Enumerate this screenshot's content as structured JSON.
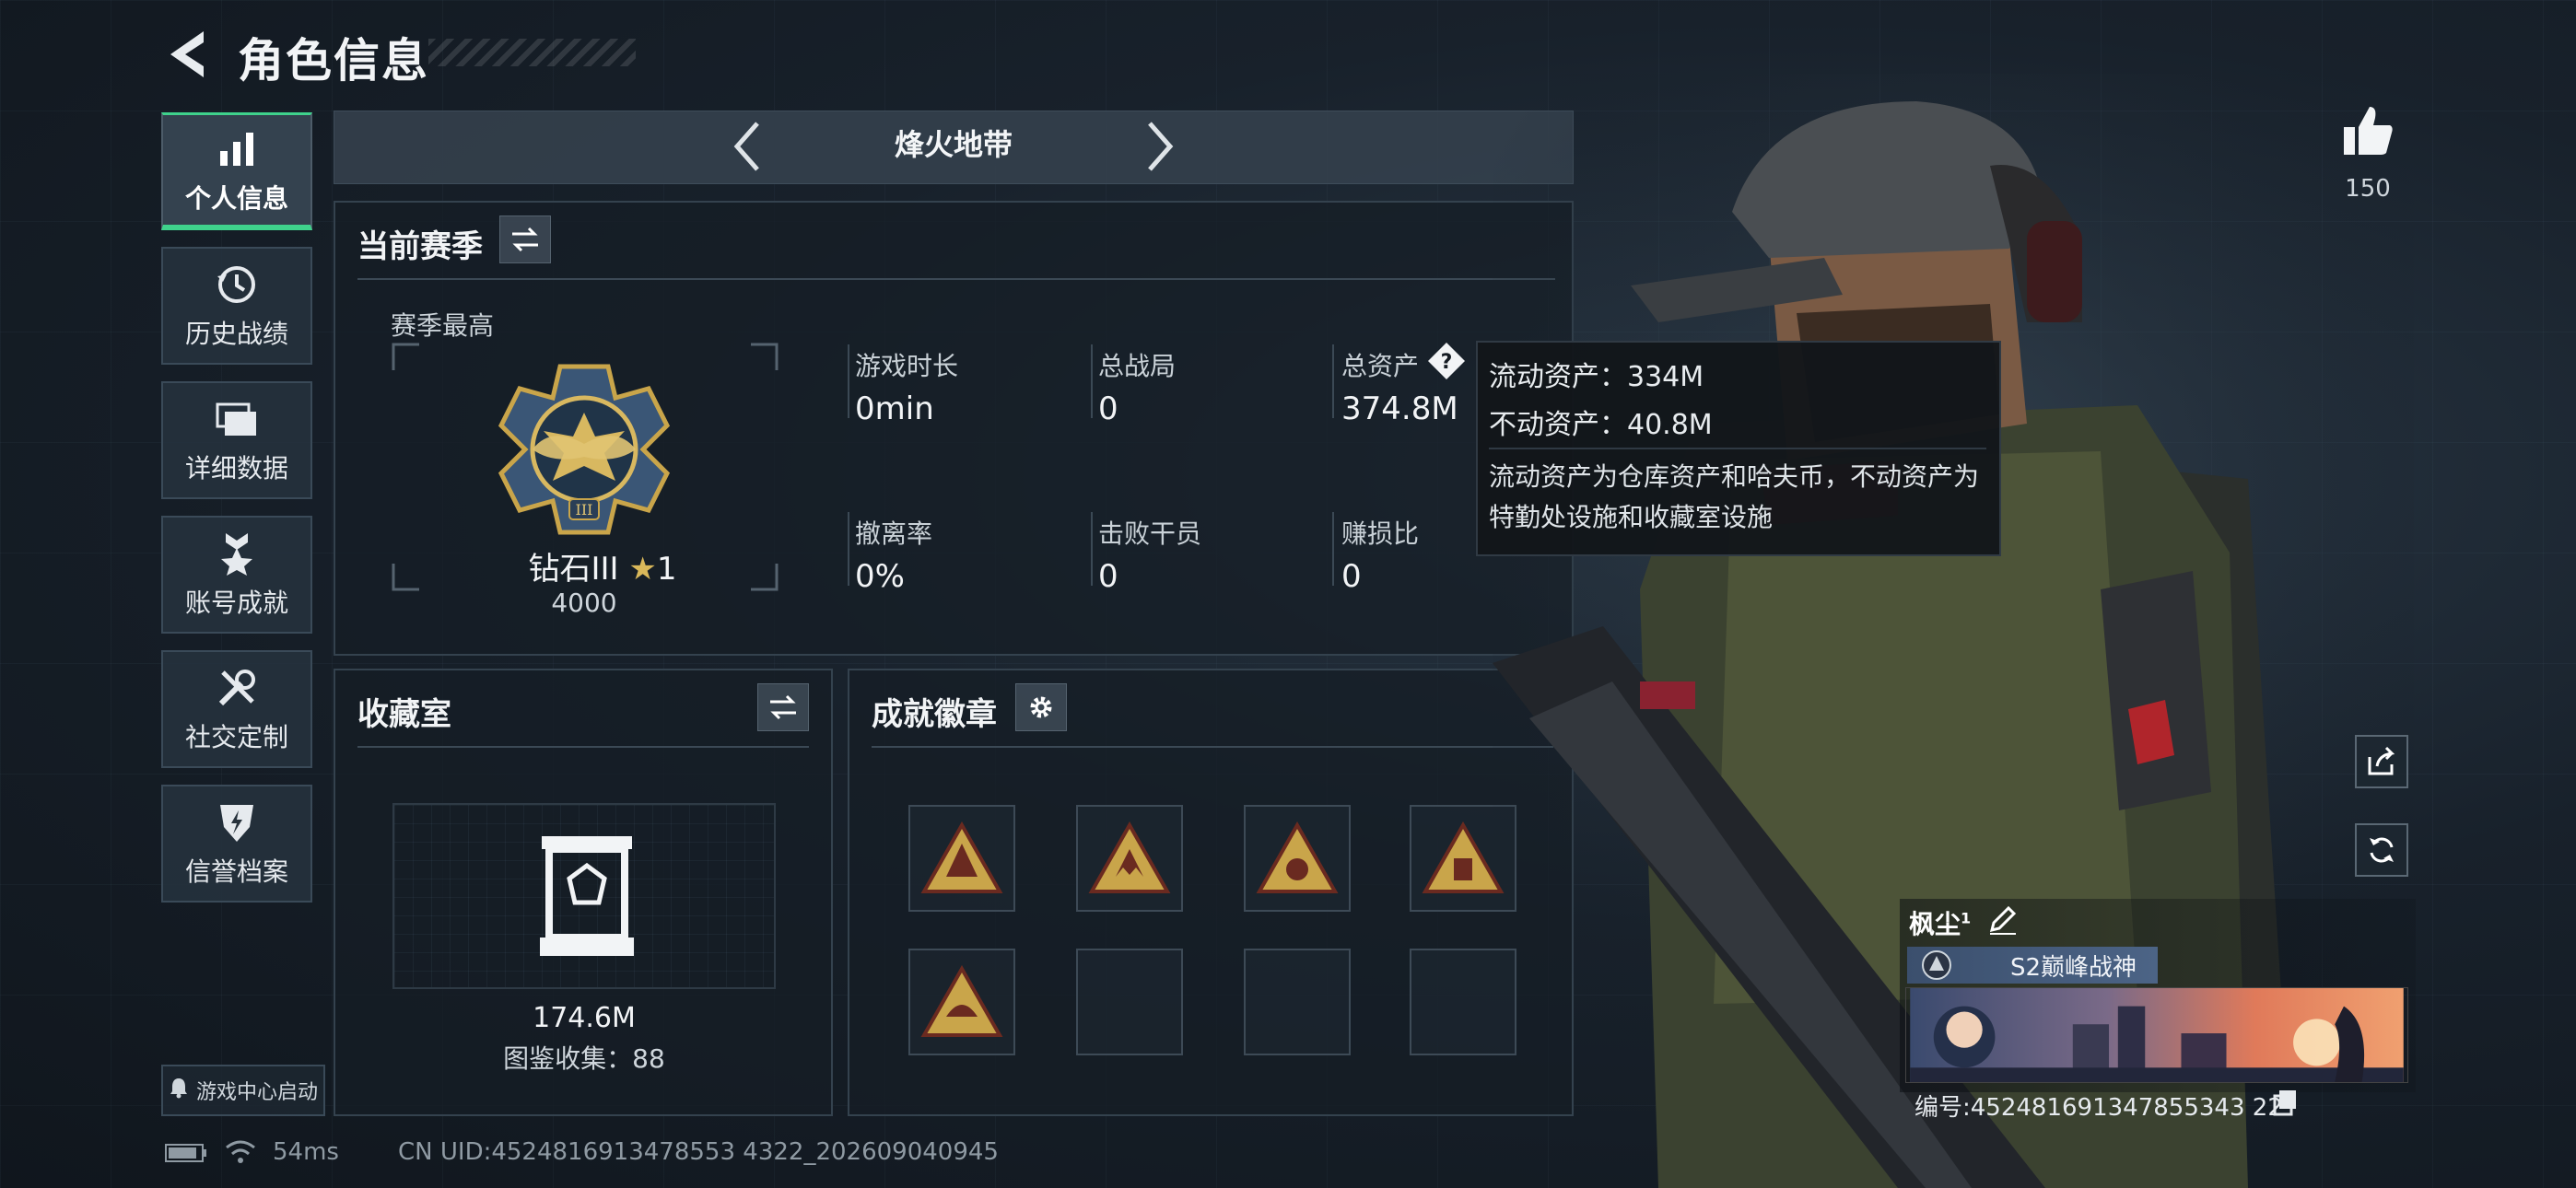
{
  "header": {
    "title": "角色信息"
  },
  "sidebar": {
    "items": [
      {
        "label": "个人信息",
        "icon": "bar-chart-icon",
        "active": true
      },
      {
        "label": "历史战绩",
        "icon": "history-clock-icon"
      },
      {
        "label": "详细数据",
        "icon": "folder-icon"
      },
      {
        "label": "账号成就",
        "icon": "medal-star-icon"
      },
      {
        "label": "社交定制",
        "icon": "tools-icon"
      },
      {
        "label": "信誉档案",
        "icon": "shield-bolt-icon"
      }
    ],
    "game_center_label": "游戏中心启动"
  },
  "mode": {
    "label": "烽火地带"
  },
  "season": {
    "title": "当前赛季",
    "best_label": "赛季最高",
    "rank_name": "钻石III",
    "rank_stars": "1",
    "rank_score": "4000",
    "stats": [
      {
        "label": "游戏时长",
        "value": "0min"
      },
      {
        "label": "总战局",
        "value": "0"
      },
      {
        "label": "总资产",
        "value": "374.8M"
      },
      {
        "label": "撤离率",
        "value": "0%"
      },
      {
        "label": "击败干员",
        "value": "0"
      },
      {
        "label": "赚损比",
        "value": "0"
      }
    ]
  },
  "tooltip": {
    "liquid": "流动资产：334M",
    "fixed": "不动资产：40.8M",
    "desc": "流动资产为仓库资产和哈夫币，不动资产为特勤处设施和收藏室设施"
  },
  "collection": {
    "title": "收藏室",
    "value": "174.6M",
    "catalog": "图鉴收集：88"
  },
  "badges": {
    "title": "成就徽章",
    "slots_filled": 5,
    "slots_total": 8
  },
  "profile": {
    "likes": "150",
    "name": "枫尘",
    "name_sup": "1",
    "title_badge": "S2巅峰战神",
    "id": "编号:452481691347855343 22"
  },
  "status": {
    "ping": "54ms",
    "uid": "CN UID:4524816913478553 4322_202609040945"
  },
  "colors": {
    "accent": "#3fd28c",
    "panel_border": "#34424e",
    "gold": "#c9a54a"
  }
}
